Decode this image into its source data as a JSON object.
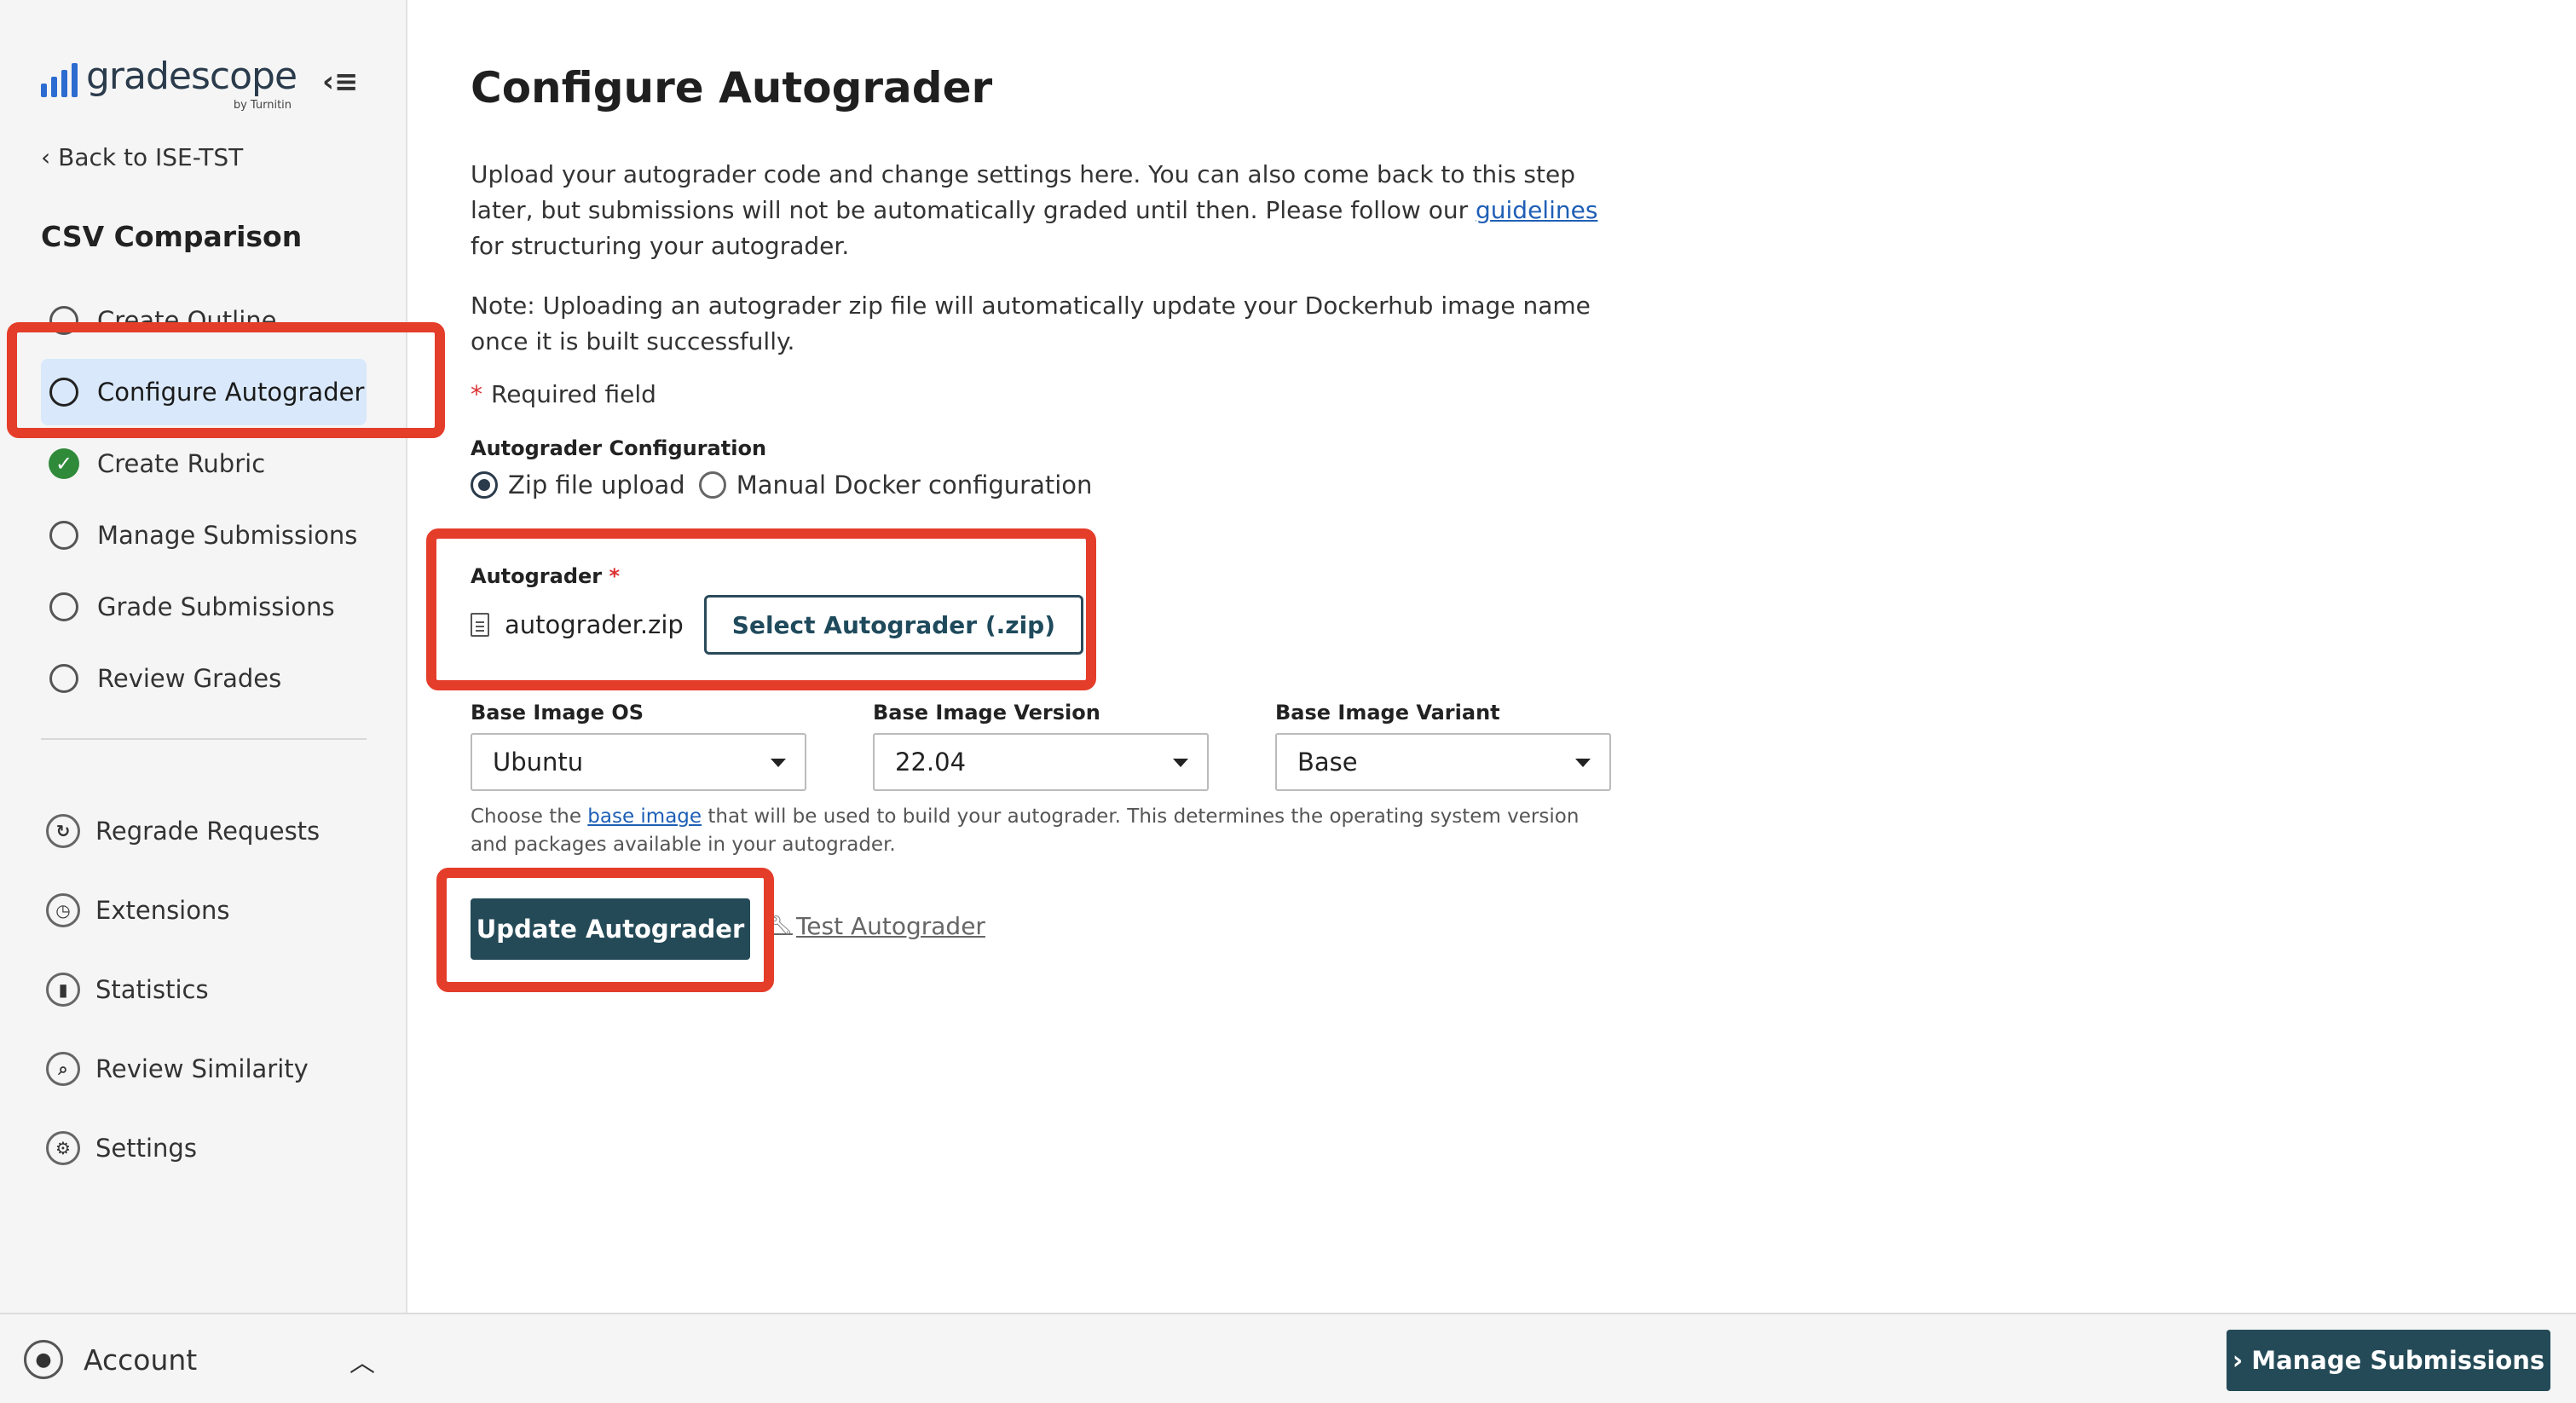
{
  "brand": {
    "name": "gradescope",
    "sub": "by Turnitin",
    "color": "#2c6cd0"
  },
  "sidebar": {
    "collapse_glyph": "‹≡",
    "back_link": "Back to ISE-TST",
    "course_title": "CSV Comparison",
    "steps": [
      {
        "label": "Create Outline",
        "state": "incomplete"
      },
      {
        "label": "Configure Autograder",
        "state": "active"
      },
      {
        "label": "Create Rubric",
        "state": "complete"
      },
      {
        "label": "Manage Submissions",
        "state": "incomplete"
      },
      {
        "label": "Grade Submissions",
        "state": "incomplete"
      },
      {
        "label": "Review Grades",
        "state": "incomplete"
      }
    ],
    "tools": [
      {
        "label": "Regrade Requests",
        "icon": "regrade-icon"
      },
      {
        "label": "Extensions",
        "icon": "clock-icon"
      },
      {
        "label": "Statistics",
        "icon": "bar-chart-icon"
      },
      {
        "label": "Review Similarity",
        "icon": "magnifier-icon"
      },
      {
        "label": "Settings",
        "icon": "gear-icon"
      }
    ],
    "account_label": "Account"
  },
  "main": {
    "title": "Configure Autograder",
    "intro_before_link": "Upload your autograder code and change settings here. You can also come back to this step later, but submissions will not be automatically graded until then. Please follow our ",
    "intro_link": "guidelines",
    "intro_after_link": " for structuring your autograder.",
    "note": "Note: Uploading an autograder zip file will automatically update your Dockerhub image name once it is built successfully.",
    "required_star": "*",
    "required_text": "Required field",
    "config_label": "Autograder Configuration",
    "radio_zip": "Zip file upload",
    "radio_docker": "Manual Docker configuration",
    "autograder_label": "Autograder",
    "autograder_star": "*",
    "file_name": "autograder.zip",
    "select_button": "Select Autograder (.zip)",
    "os_label": "Base Image OS",
    "os_value": "Ubuntu",
    "version_label": "Base Image Version",
    "version_value": "22.04",
    "variant_label": "Base Image Variant",
    "variant_value": "Base",
    "help_before_link": "Choose the ",
    "help_link": "base image",
    "help_after_link": " that will be used to build your autograder. This determines the operating system version and packages available in your autograder.",
    "update_button": "Update Autograder",
    "test_link": "Test Autograder"
  },
  "footer": {
    "manage_button": "Manage Submissions"
  },
  "colors": {
    "highlight": "#e43d2a",
    "primary_button": "#244a57",
    "active_step_bg": "#d9e8fa",
    "complete_check": "#2f8a3a"
  }
}
